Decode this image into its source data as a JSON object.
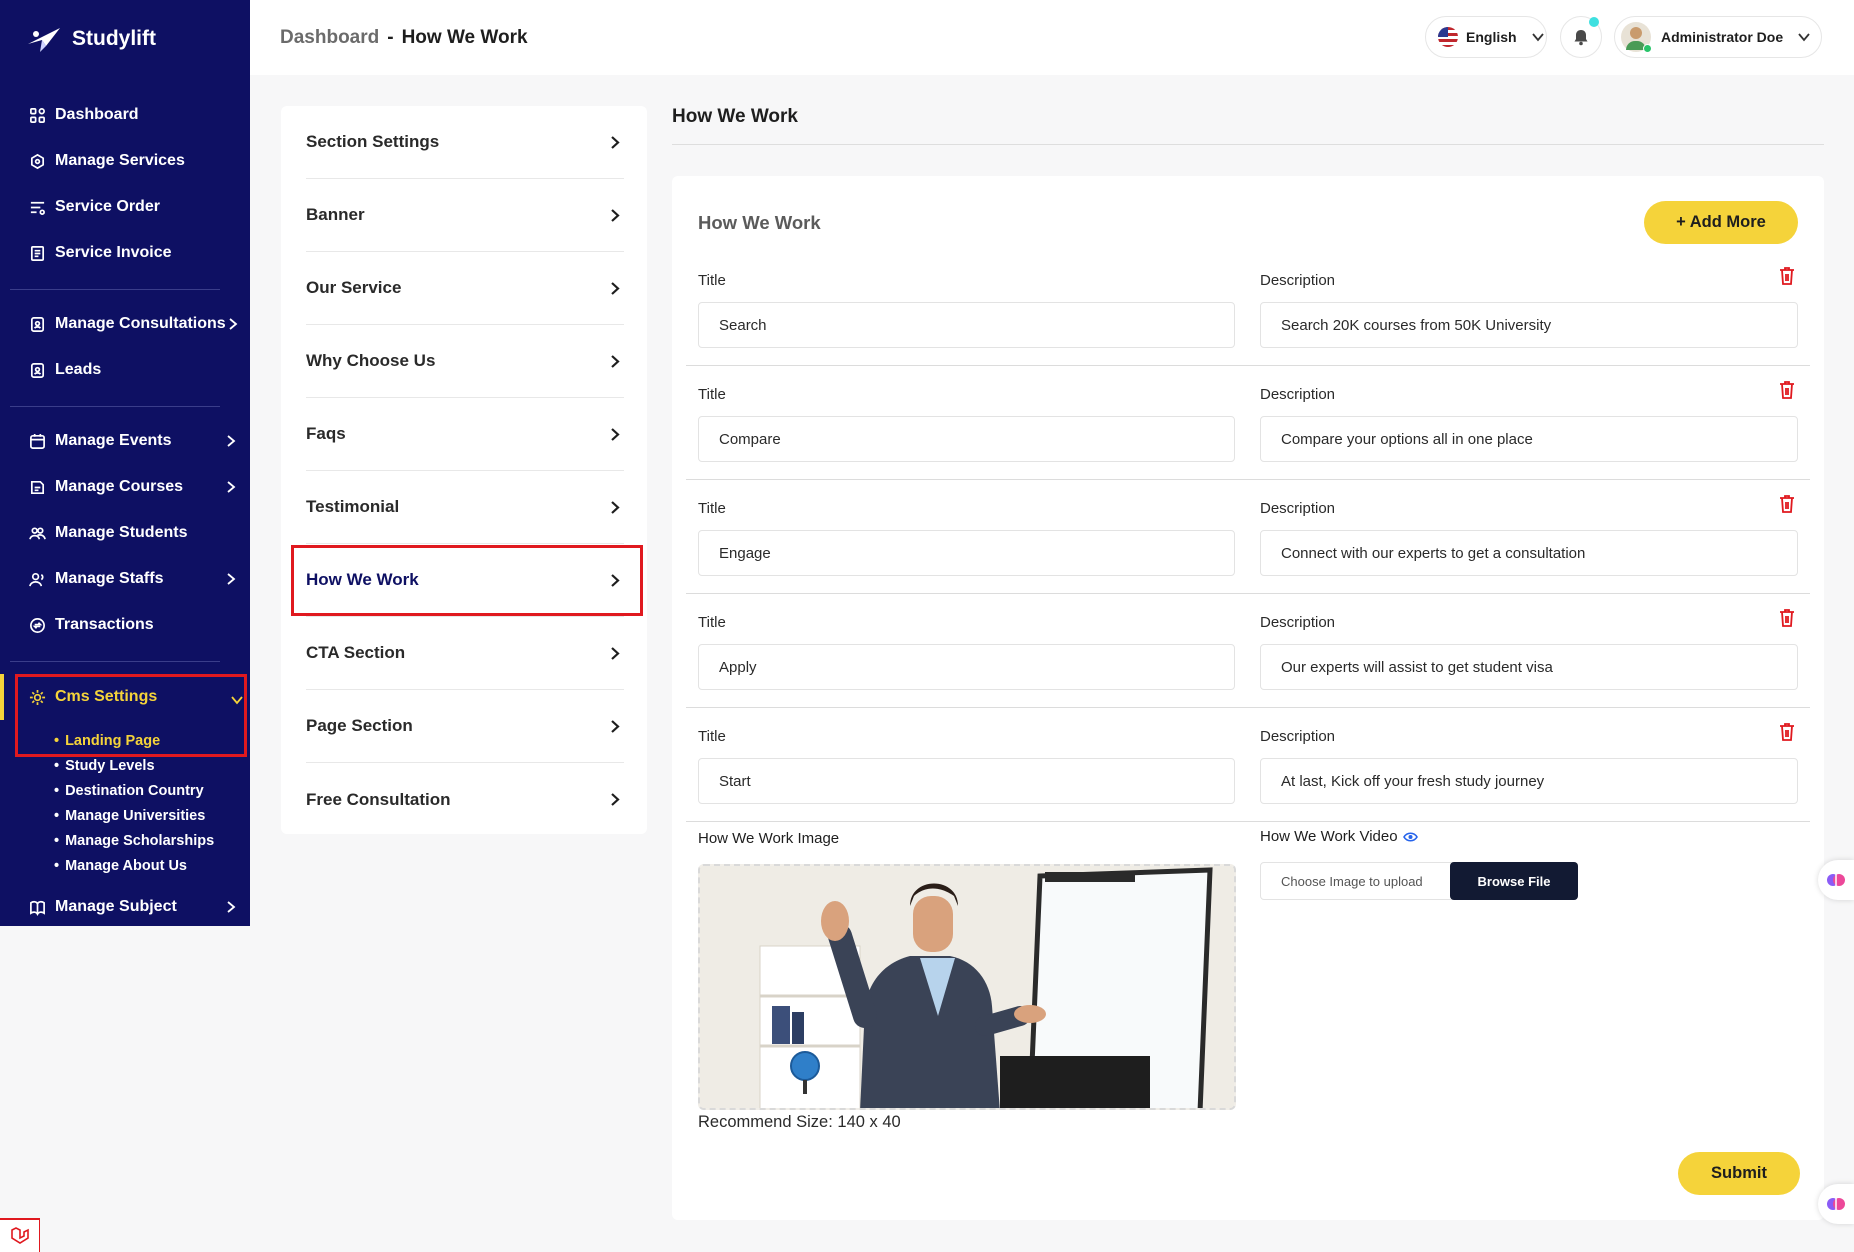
{
  "app": {
    "name": "Studylift"
  },
  "sidebar": {
    "groups": [
      [
        {
          "label": "Dashboard",
          "icon": "dashboard-icon"
        },
        {
          "label": "Manage Services",
          "icon": "services-icon"
        },
        {
          "label": "Service Order",
          "icon": "order-icon"
        },
        {
          "label": "Service Invoice",
          "icon": "invoice-icon"
        }
      ],
      [
        {
          "label": "Manage Consultations",
          "icon": "consultation-icon"
        },
        {
          "label": "Leads",
          "icon": "leads-icon"
        }
      ],
      [
        {
          "label": "Manage Events",
          "icon": "calendar-icon"
        },
        {
          "label": "Manage Courses",
          "icon": "courses-icon"
        },
        {
          "label": "Manage Students",
          "icon": "students-icon"
        },
        {
          "label": "Manage Staffs",
          "icon": "staffs-icon"
        },
        {
          "label": "Transactions",
          "icon": "transactions-icon"
        }
      ]
    ],
    "cms": {
      "label": "Cms Settings",
      "sub_items": [
        "Landing Page",
        "Study Levels",
        "Destination Country",
        "Manage Universities",
        "Manage Scholarships",
        "Manage About Us"
      ]
    },
    "last": {
      "label": "Manage Subject"
    }
  },
  "header": {
    "breadcrumb_root": "Dashboard",
    "breadcrumb_sep": "-",
    "breadcrumb_current": "How We Work",
    "language": "English",
    "user_name": "Administrator Doe"
  },
  "settings_menu": [
    "Section Settings",
    "Banner",
    "Our Service",
    "Why Choose Us",
    "Faqs",
    "Testimonial",
    "How We Work",
    "CTA Section",
    "Page Section",
    "Free Consultation"
  ],
  "main": {
    "page_title": "How We Work",
    "card_title": "How We Work",
    "add_more_label": "+ Add More",
    "title_label": "Title",
    "description_label": "Description",
    "rows": [
      {
        "title": "Search",
        "description": "Search 20K courses from  50K University"
      },
      {
        "title": "Compare",
        "description": "Compare your options all in one place"
      },
      {
        "title": "Engage",
        "description": "Connect with our experts to get a consultation"
      },
      {
        "title": "Apply",
        "description": "Our experts will assist to get student visa"
      },
      {
        "title": "Start",
        "description": "At last, Kick off your  fresh study journey"
      }
    ],
    "image_label": "How We Work Image",
    "recommend_size": "Recommend Size: 140 x 40",
    "video_label": "How We Work Video",
    "file_placeholder": "Choose Image to upload",
    "browse_label": "Browse File",
    "submit_label": "Submit"
  },
  "colors": {
    "sidebar_bg": "#0e1063",
    "accent_yellow": "#f5d33a",
    "highlight_red": "#e0191f",
    "browse_bg": "#121a33"
  }
}
